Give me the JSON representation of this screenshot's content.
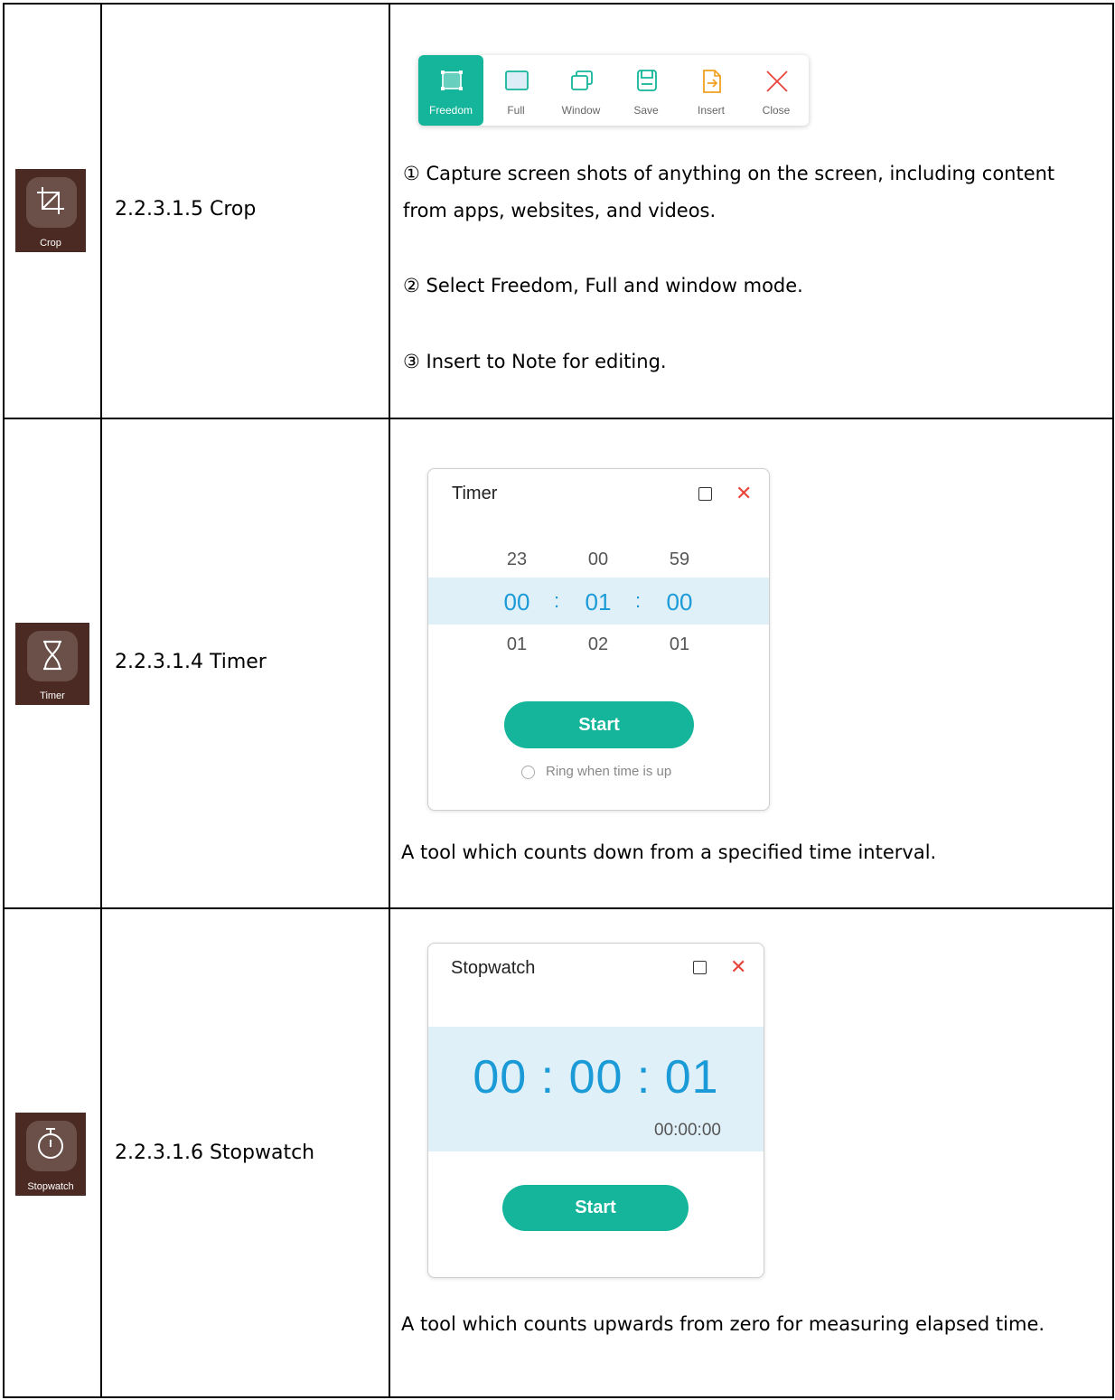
{
  "rows": [
    {
      "icon_label": "Crop",
      "icon_name": "crop-icon",
      "title": "2.2.3.1.5 Crop",
      "toolbar": [
        {
          "label": "Freedom",
          "icon": "freedom-select-icon",
          "active": true
        },
        {
          "label": "Full",
          "icon": "full-screen-icon",
          "active": false
        },
        {
          "label": "Window",
          "icon": "window-icon",
          "active": false
        },
        {
          "label": "Save",
          "icon": "save-icon",
          "active": false
        },
        {
          "label": "Insert",
          "icon": "insert-icon",
          "active": false
        },
        {
          "label": "Close",
          "icon": "close-icon",
          "active": false
        }
      ],
      "desc": [
        "① Capture screen shots of anything on the screen, including content",
        "from apps, websites, and videos.",
        "② Select Freedom, Full and window mode.",
        "③ Insert to Note for editing."
      ]
    },
    {
      "icon_label": "Timer",
      "icon_name": "hourglass-icon",
      "title": "2.2.3.1.4 Timer",
      "dialog": {
        "title": "Timer",
        "above": [
          "23",
          "00",
          "59"
        ],
        "selected": [
          "00",
          "01",
          "00"
        ],
        "below": [
          "01",
          "02",
          "01"
        ],
        "separator": ":",
        "button": "Start",
        "ring_label": "Ring when time is up"
      },
      "desc": "A tool which counts down from a specified time interval."
    },
    {
      "icon_label": "Stopwatch",
      "icon_name": "stopwatch-icon",
      "title": "2.2.3.1.6 Stopwatch",
      "dialog": {
        "title": "Stopwatch",
        "big_time": "00 : 00 : 01",
        "small_time": "00:00:00",
        "button": "Start"
      },
      "desc": "A tool which counts upwards from zero for measuring elapsed time."
    }
  ],
  "colors": {
    "accent": "#14b59a",
    "time_blue": "#1a9ad6",
    "highlight_band": "#dff0f8",
    "close_red": "#e8453c",
    "icon_bg": "#4a2a22"
  }
}
